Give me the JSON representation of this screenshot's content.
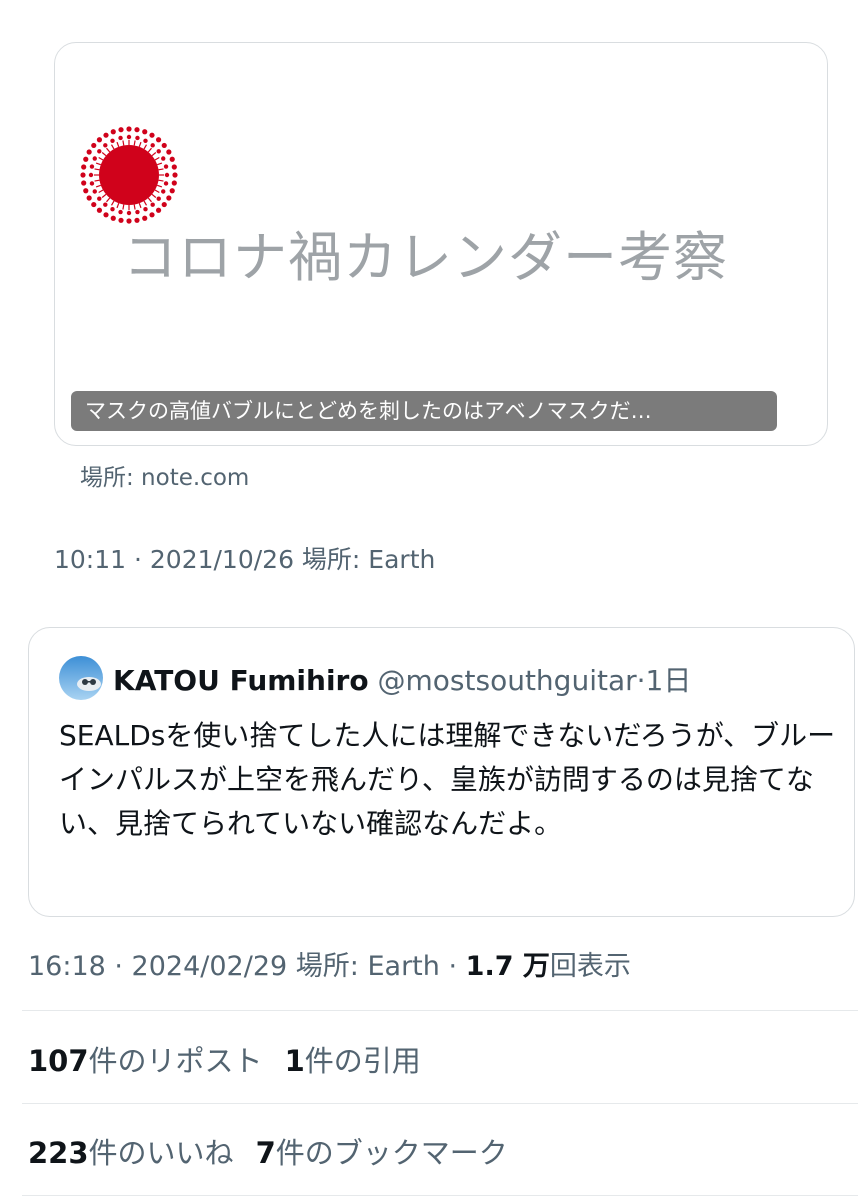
{
  "link_card": {
    "headline": "コロナ禍カレンダー考察",
    "caption": "マスクの高値バブルにとどめを刺したのはアベノマスクだ…",
    "source": "場所: note.com",
    "logo_color": "#d0021b",
    "logo_icon": "sun-burst-icon"
  },
  "original_meta": "10:11 · 2021/10/26  場所: Earth",
  "quote": {
    "name": "KATOU Fumihiro",
    "handle": "@mostsouthguitar",
    "separator": "·",
    "time": "1日",
    "text": "SEALDsを使い捨てした人には理解できないだろうが、ブルーインパルスが上空を飛んだり、皇族が訪問するのは見捨てない、見捨てられていない確認なんだよ。"
  },
  "post_meta": {
    "time": "16:18 · 2024/02/29",
    "location": "場所: Earth",
    "separator": "·",
    "views_num": "1.7 万",
    "views_label": "回表示"
  },
  "stats": {
    "reposts_num": "107",
    "reposts_label": "件のリポスト",
    "quotes_num": "1",
    "quotes_label": "件の引用",
    "likes_num": "223",
    "likes_label": "件のいいね",
    "bookmarks_num": "7",
    "bookmarks_label": "件のブックマーク"
  }
}
